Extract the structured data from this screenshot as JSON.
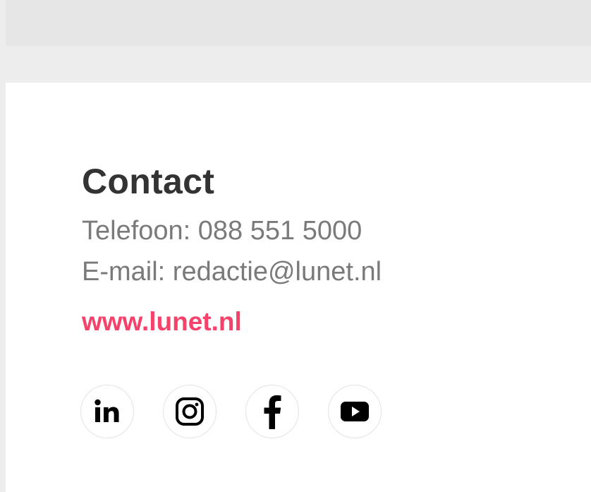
{
  "contact": {
    "title": "Contact",
    "phone": "Telefoon: 088 551 5000",
    "email": "E-mail: redactie@lunet.nl",
    "website": "www.lunet.nl"
  },
  "social": [
    {
      "icon": "linkedin-icon"
    },
    {
      "icon": "instagram-icon"
    },
    {
      "icon": "facebook-icon"
    },
    {
      "icon": "youtube-icon"
    }
  ],
  "colors": {
    "heading": "#333333",
    "text": "#7a7a7a",
    "link": "#f5426a",
    "icon": "#000000"
  }
}
